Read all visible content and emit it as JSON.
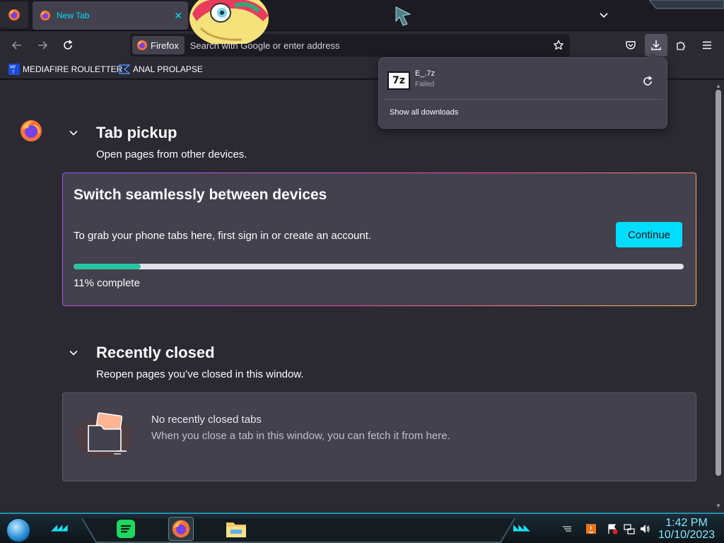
{
  "tabs": [
    {
      "title": "New Tab",
      "active": true
    }
  ],
  "navbar": {
    "identity_label": "Firefox",
    "search_placeholder": "Search with Google or enter address"
  },
  "bookmarks": [
    {
      "label": "MEDIAFIRE ROULETTER",
      "icon": "mediafire-icon"
    },
    {
      "label": "ANAL PROLAPSE",
      "icon": "bookmark-favicon-icon"
    }
  ],
  "tab_pickup": {
    "heading": "Tab pickup",
    "subtitle": "Open pages from other devices.",
    "card_title": "Switch seamlessly between devices",
    "card_message": "To grab your phone tabs here, first sign in or create an account.",
    "continue_label": "Continue",
    "progress_percent": 11,
    "progress_text": "11% complete"
  },
  "recently_closed": {
    "heading": "Recently closed",
    "subtitle": "Reopen pages you’ve closed in this window.",
    "empty_title": "No recently closed tabs",
    "empty_desc": "When you close a tab in this window, you can fetch it from here."
  },
  "downloads_panel": {
    "items": [
      {
        "filename": "E_.7z",
        "status": "Failed",
        "icon_text": "7z"
      }
    ],
    "show_all_label": "Show all downloads"
  },
  "taskbar": {
    "time": "1:42 PM",
    "date": "10/10/2023",
    "pinned": [
      "spotify-icon",
      "firefox-icon",
      "file-explorer-icon"
    ]
  },
  "colors": {
    "accent": "#00ddff",
    "progress_fill": "#2ac3a2",
    "page_bg": "#2b2a33",
    "card_bg": "#42414d"
  }
}
